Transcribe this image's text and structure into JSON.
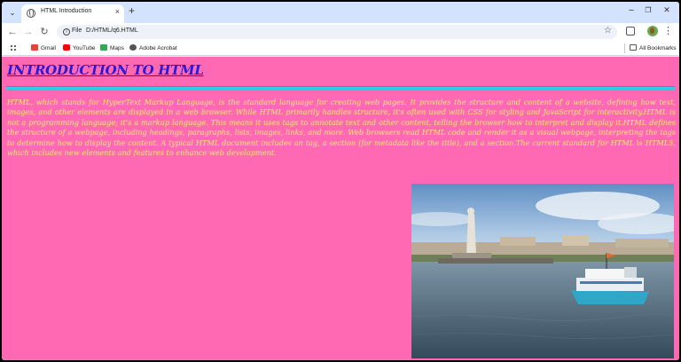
{
  "browser": {
    "tab_menu_icon": "chevron-down-icon",
    "tab_title": "HTML Introduction",
    "tab_close": "×",
    "new_tab": "+",
    "window_controls": {
      "minimize": "–",
      "restore": "❐",
      "close": "✕"
    },
    "nav": {
      "back": "←",
      "forward": "→",
      "reload": "↻"
    },
    "omnibox": {
      "scheme_chip": "File",
      "url": "D:/HTML/q6.HTML",
      "bookmark_icon": "☆"
    },
    "menu_icon": "⋮"
  },
  "bookmarks": {
    "items": [
      {
        "label": "Gmail",
        "icon_color": "#ea4335"
      },
      {
        "label": "YouTube",
        "icon_color": "#ff0000"
      },
      {
        "label": "Maps",
        "icon_color": "#34a853"
      },
      {
        "label": "Adobe Acrobat",
        "icon_color": "#555555"
      }
    ],
    "all_bookmarks": "All Bookmarks"
  },
  "page": {
    "background": "#ff69b4",
    "heading": "INTRODUCTION TO HTML",
    "rule_color": "#33c9e8",
    "paragraph": "HTML, which stands for HyperText Markup Language, is the standard language for creating web pages. It provides the structure and content of a website, defining how text, images, and other elements are displayed in a web browser. While HTML primarily handles structure, it's often used with CSS for styling and JavaScript for interactivity.HTML is not a programming language; it's a markup language. This means it uses tags to annotate text and other content, telling the browser how to interpret and display it.HTML defines the structure of a webpage, including headings, paragraphs, lists, images, links, and more. Web browsers read HTML code and render it as a visual webpage, interpreting the tags to determine how to display the content. A typical HTML document includes an tag, a section (for metadata like the title), and a section.The current standard for HTML is HTML5, which includes new elements and features to enhance web development.",
    "paragraph_color": "#fdf06a"
  }
}
